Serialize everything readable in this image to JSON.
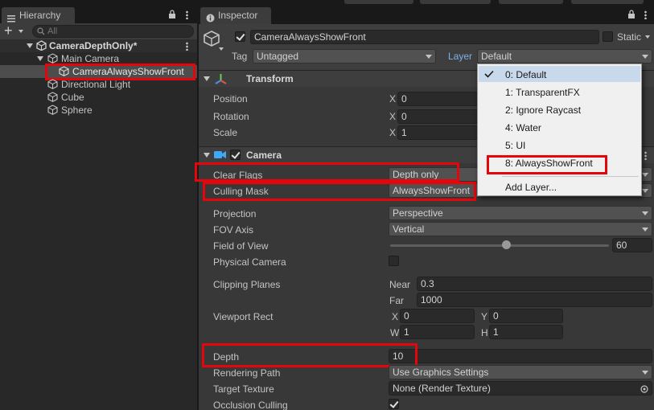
{
  "hierarchy": {
    "tab_label": "Hierarchy",
    "search_placeholder": "All",
    "add_symbol": "+",
    "items": [
      {
        "label": "CameraDepthOnly*"
      },
      {
        "label": "Main Camera"
      },
      {
        "label": "CameraAlwaysShowFront"
      },
      {
        "label": "Directional Light"
      },
      {
        "label": "Cube"
      },
      {
        "label": "Sphere"
      }
    ]
  },
  "inspector": {
    "tab_label": "Inspector",
    "object_name": "CameraAlwaysShowFront",
    "static_label": "Static",
    "tag_label": "Tag",
    "tag_value": "Untagged",
    "layer_label": "Layer",
    "layer_value": "Default",
    "transform": {
      "title": "Transform",
      "position_label": "Position",
      "position_x": "0",
      "rotation_label": "Rotation",
      "rotation_x": "0",
      "scale_label": "Scale",
      "scale_x": "1",
      "x_label": "X"
    },
    "camera": {
      "title": "Camera",
      "clear_flags_label": "Clear Flags",
      "clear_flags_value": "Depth only",
      "culling_mask_label": "Culling Mask",
      "culling_mask_value": "AlwaysShowFront",
      "projection_label": "Projection",
      "projection_value": "Perspective",
      "fov_axis_label": "FOV Axis",
      "fov_axis_value": "Vertical",
      "field_of_view_label": "Field of View",
      "field_of_view_value": "60",
      "field_of_view_fraction": 0.53,
      "physical_camera_label": "Physical Camera",
      "clipping_planes_label": "Clipping Planes",
      "near_label": "Near",
      "near_value": "0.3",
      "far_label": "Far",
      "far_value": "1000",
      "viewport_rect_label": "Viewport Rect",
      "vx_label": "X",
      "vx_value": "0",
      "vy_label": "Y",
      "vy_value": "0",
      "vw_label": "W",
      "vw_value": "1",
      "vh_label": "H",
      "vh_value": "1",
      "depth_label": "Depth",
      "depth_value": "10",
      "rendering_path_label": "Rendering Path",
      "rendering_path_value": "Use Graphics Settings",
      "target_texture_label": "Target Texture",
      "target_texture_value": "None (Render Texture)",
      "occlusion_culling_label": "Occlusion Culling"
    }
  },
  "layer_menu": {
    "items": [
      {
        "label": "0: Default",
        "checked": true
      },
      {
        "label": "1: TransparentFX"
      },
      {
        "label": "2: Ignore Raycast"
      },
      {
        "label": "4: Water"
      },
      {
        "label": "5: UI"
      },
      {
        "label": "8: AlwaysShowFront"
      }
    ],
    "add_layer_label": "Add Layer..."
  },
  "colors": {
    "highlight_red": "#e5060c",
    "menu_selection": "#c9d9ec",
    "panel_bg": "#383838"
  }
}
